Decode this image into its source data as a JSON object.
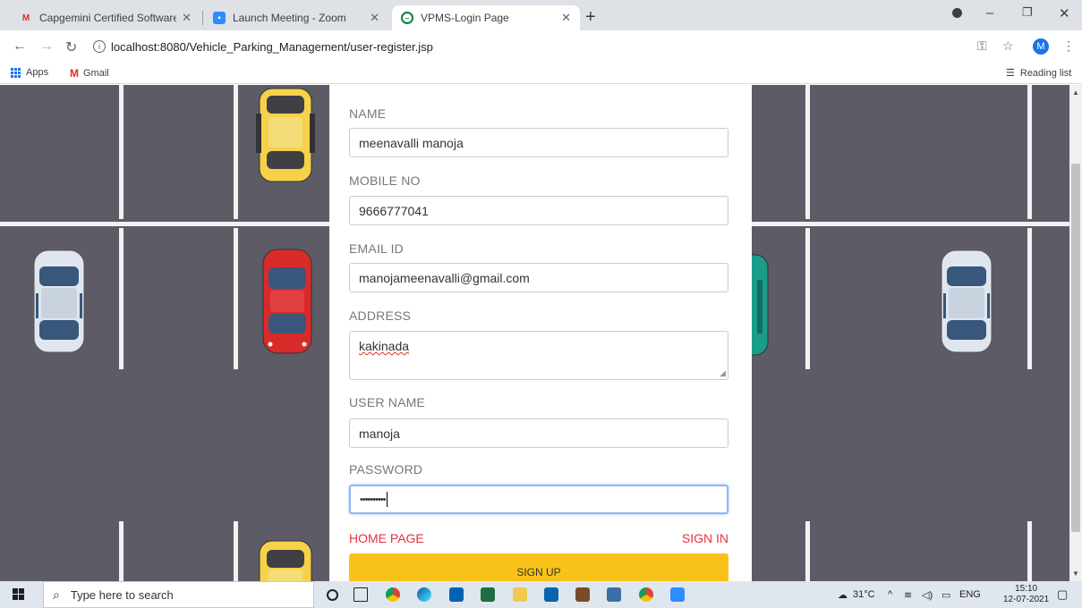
{
  "browser": {
    "tabs": [
      {
        "title": "Capgemini Certified Software De",
        "icon": "gmail-icon"
      },
      {
        "title": "Launch Meeting - Zoom",
        "icon": "zoom-icon"
      },
      {
        "title": "VPMS-Login Page",
        "icon": "page-icon"
      }
    ],
    "url": "localhost:8080/Vehicle_Parking_Management/user-register.jsp",
    "profile_initial": "M",
    "bookmarks": [
      {
        "label": "Apps",
        "icon": "apps-grid-icon"
      },
      {
        "label": "Gmail",
        "icon": "gmail-icon"
      }
    ],
    "reading_list": "Reading list"
  },
  "form": {
    "name_label": "NAME",
    "name_value": "meenavalli manoja",
    "mobile_label": "MOBILE NO",
    "mobile_value": "9666777041",
    "email_label": "EMAIL ID",
    "email_value": "manojameenavalli@gmail.com",
    "address_label": "ADDRESS",
    "address_value": "kakinada",
    "username_label": "USER NAME",
    "username_value": "manoja",
    "password_label": "PASSWORD",
    "password_value": "••••••••••",
    "home_link": "HOME PAGE",
    "signin_link": "SIGN IN",
    "signup_button": "SIGN UP"
  },
  "taskbar": {
    "search_placeholder": "Type here to search",
    "weather": "31°C",
    "language": "ENG",
    "time": "15:10",
    "date": "12-07-2021"
  },
  "colors": {
    "parking_asphalt": "#5d5c66",
    "link_red": "#e6323e",
    "signup_yellow": "#f9c21a",
    "car_yellow": "#f6d14a",
    "car_red": "#d92a2a",
    "car_white": "#dfe6ef",
    "car_teal": "#1a9c8a"
  }
}
